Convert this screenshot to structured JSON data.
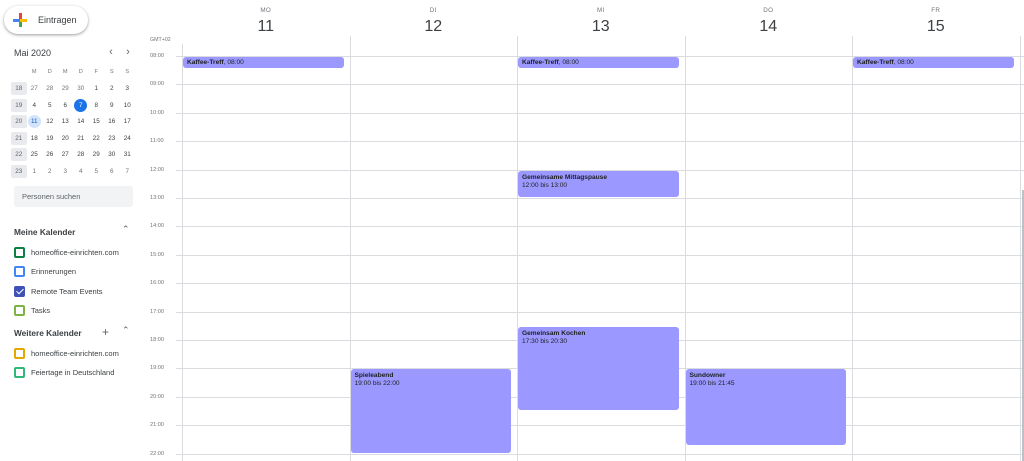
{
  "create_label": "Eintragen",
  "mini": {
    "title": "Mai 2020",
    "prev": "‹",
    "next": "›",
    "weekdays": [
      "M",
      "D",
      "M",
      "D",
      "F",
      "S",
      "S"
    ],
    "weeks": [
      {
        "wk": "18",
        "days": [
          "27",
          "28",
          "29",
          "30",
          "1",
          "2",
          "3"
        ]
      },
      {
        "wk": "19",
        "days": [
          "4",
          "5",
          "6",
          "7",
          "8",
          "9",
          "10"
        ]
      },
      {
        "wk": "20",
        "days": [
          "11",
          "12",
          "13",
          "14",
          "15",
          "16",
          "17"
        ]
      },
      {
        "wk": "21",
        "days": [
          "18",
          "19",
          "20",
          "21",
          "22",
          "23",
          "24"
        ]
      },
      {
        "wk": "22",
        "days": [
          "25",
          "26",
          "27",
          "28",
          "29",
          "30",
          "31"
        ]
      },
      {
        "wk": "23",
        "days": [
          "1",
          "2",
          "3",
          "4",
          "5",
          "6",
          "7"
        ]
      }
    ]
  },
  "search_placeholder": "Personen suchen",
  "my_cal": {
    "title": "Meine Kalender",
    "items": [
      {
        "label": "homeoffice-einrichten.com",
        "color": "#0b8043",
        "checked": false
      },
      {
        "label": "Erinnerungen",
        "color": "#4285f4",
        "checked": false
      },
      {
        "label": "Remote Team Events",
        "color": "#3f51b5",
        "checked": true
      },
      {
        "label": "Tasks",
        "color": "#7cb342",
        "checked": false
      }
    ]
  },
  "other_cal": {
    "title": "Weitere Kalender",
    "items": [
      {
        "label": "homeoffice-einrichten.com",
        "color": "#e4a700",
        "checked": false
      },
      {
        "label": "Feiertage in Deutschland",
        "color": "#33b679",
        "checked": false
      }
    ]
  },
  "timezone": "GMT+02",
  "days": [
    {
      "name": "MO",
      "num": "11"
    },
    {
      "name": "DI",
      "num": "12"
    },
    {
      "name": "MI",
      "num": "13"
    },
    {
      "name": "DO",
      "num": "14"
    },
    {
      "name": "FR",
      "num": "15"
    }
  ],
  "hours": [
    "08:00",
    "09:00",
    "10:00",
    "11:00",
    "12:00",
    "13:00",
    "14:00",
    "15:00",
    "16:00",
    "17:00",
    "18:00",
    "19:00",
    "20:00",
    "21:00",
    "22:00"
  ],
  "events": [
    {
      "day": 0,
      "title": "Kaffee-Treff",
      "time": "08:00",
      "start": 8.0,
      "end": 8.5,
      "inline": true
    },
    {
      "day": 2,
      "title": "Kaffee-Treff",
      "time": "08:00",
      "start": 8.0,
      "end": 8.5,
      "inline": true
    },
    {
      "day": 4,
      "title": "Kaffee-Treff",
      "time": "08:00",
      "start": 8.0,
      "end": 8.5,
      "inline": true
    },
    {
      "day": 2,
      "title": "Gemeinsame Mittagspause",
      "time": "12:00 bis 13:00",
      "start": 12.0,
      "end": 13.0,
      "inline": false
    },
    {
      "day": 2,
      "title": "Gemeinsam Kochen",
      "time": "17:30 bis 20:30",
      "start": 17.5,
      "end": 20.5,
      "inline": false
    },
    {
      "day": 1,
      "title": "Spieleabend",
      "time": "19:00 bis 22:00",
      "start": 19.0,
      "end": 22.0,
      "inline": false
    },
    {
      "day": 3,
      "title": "Sundowner",
      "time": "19:00 bis 21:45",
      "start": 19.0,
      "end": 21.75,
      "inline": false
    }
  ]
}
